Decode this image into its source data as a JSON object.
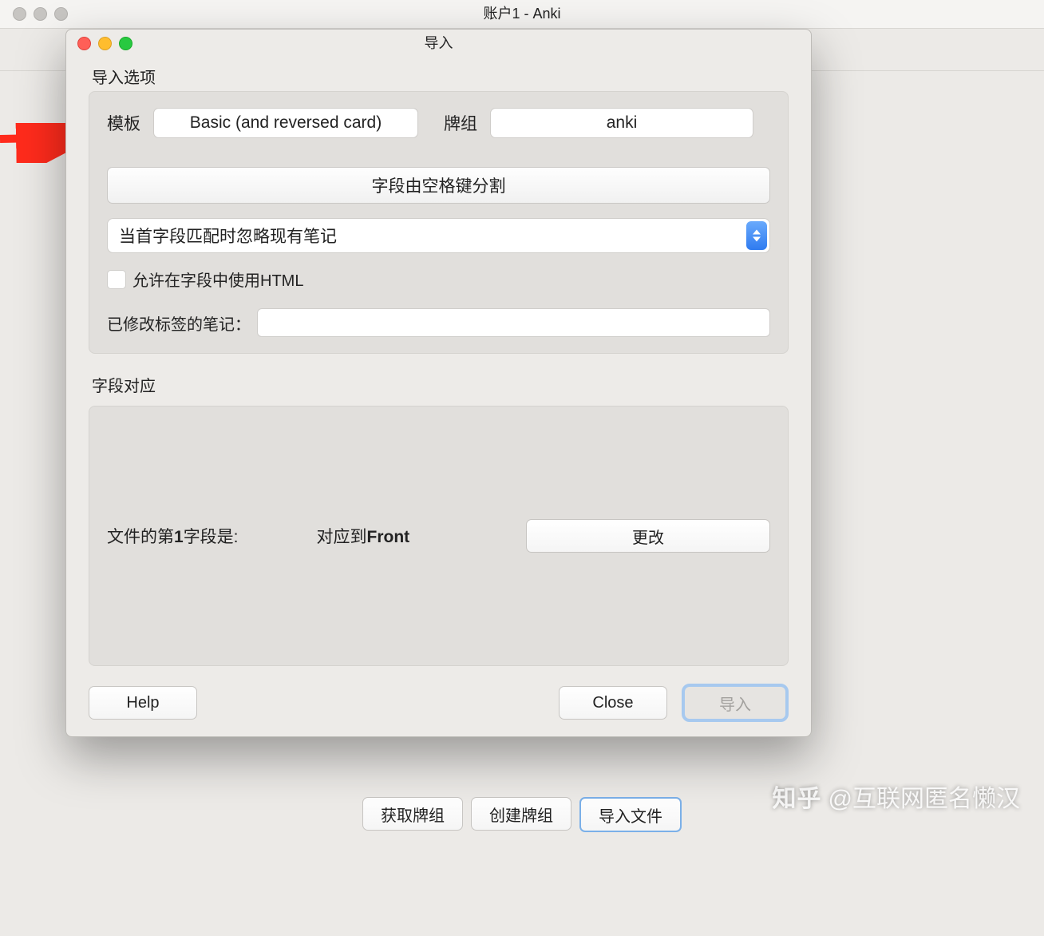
{
  "parent_window": {
    "title": "账户1 - Anki",
    "footer_buttons": {
      "get_decks": "获取牌组",
      "create_deck": "创建牌组",
      "import_file": "导入文件"
    }
  },
  "dialog": {
    "title": "导入",
    "import_options_label": "导入选项",
    "template_label": "模板",
    "template_value": "Basic (and reversed card)",
    "deck_label": "牌组",
    "deck_value": "anki",
    "separator_button": "字段由空格键分割",
    "dup_policy": "当首字段匹配时忽略现有笔记",
    "allow_html_label": "允许在字段中使用HTML",
    "allow_html_checked": false,
    "tags_label": "已修改标签的笔记：",
    "tags_value": "",
    "field_map_label": "字段对应",
    "field_map": {
      "col1_pre": "文件的第",
      "col1_bold": "1",
      "col1_post": "字段是:",
      "col2_pre": "对应到",
      "col2_bold": "Front",
      "change_button": "更改"
    },
    "footer": {
      "help": "Help",
      "close": "Close",
      "import": "导入"
    }
  },
  "watermark": {
    "brand": "知乎",
    "handle": "@互联网匿名懒汉"
  }
}
